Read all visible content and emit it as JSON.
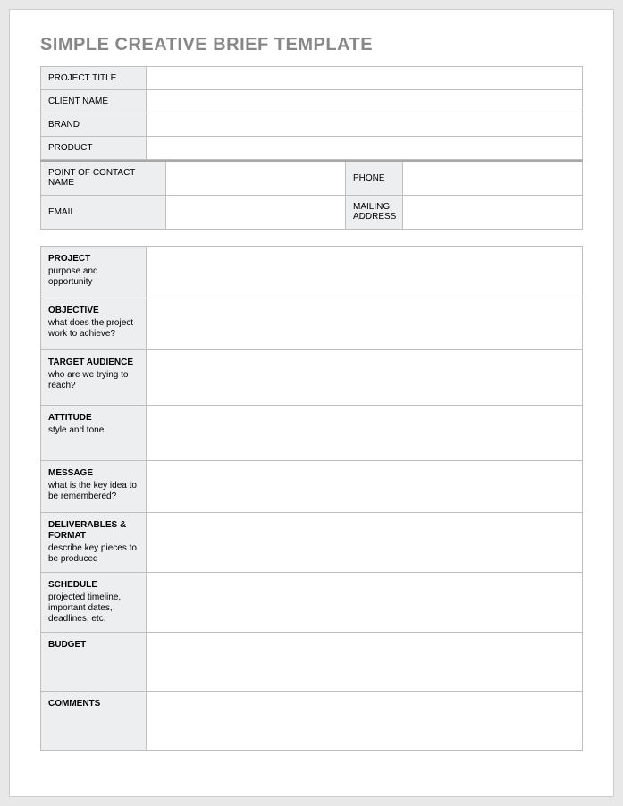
{
  "title": "SIMPLE CREATIVE BRIEF TEMPLATE",
  "info": {
    "project_title": {
      "label": "PROJECT TITLE",
      "value": ""
    },
    "client_name": {
      "label": "CLIENT NAME",
      "value": ""
    },
    "brand": {
      "label": "BRAND",
      "value": ""
    },
    "product": {
      "label": "PRODUCT",
      "value": ""
    }
  },
  "contact": {
    "poc": {
      "label": "POINT OF CONTACT NAME",
      "value": ""
    },
    "phone": {
      "label": "PHONE",
      "value": ""
    },
    "email": {
      "label": "EMAIL",
      "value": ""
    },
    "mailing": {
      "label": "MAILING ADDRESS",
      "value": ""
    }
  },
  "sections": {
    "project": {
      "head": "PROJECT",
      "sub": "purpose and opportunity",
      "value": ""
    },
    "objective": {
      "head": "OBJECTIVE",
      "sub": "what does the project work to achieve?",
      "value": ""
    },
    "audience": {
      "head": "TARGET AUDIENCE",
      "sub": "who are we trying to reach?",
      "value": ""
    },
    "attitude": {
      "head": "ATTITUDE",
      "sub": "style and tone",
      "value": ""
    },
    "message": {
      "head": "MESSAGE",
      "sub": "what is the key idea to be remembered?",
      "value": ""
    },
    "deliverables": {
      "head": "DELIVERABLES & FORMAT",
      "sub": " describe key pieces to be produced",
      "value": ""
    },
    "schedule": {
      "head": "SCHEDULE",
      "sub": "projected timeline, important dates, deadlines, etc.",
      "value": ""
    },
    "budget": {
      "head": "BUDGET",
      "sub": "",
      "value": ""
    },
    "comments": {
      "head": "COMMENTS",
      "sub": "",
      "value": ""
    }
  }
}
